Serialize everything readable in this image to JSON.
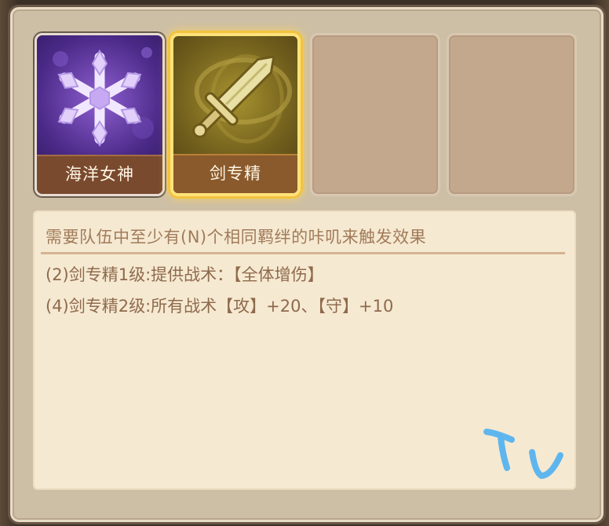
{
  "slots": [
    {
      "label": "海洋女神",
      "icon": "snowflake-icon",
      "selected": false
    },
    {
      "label": "剑专精",
      "icon": "sword-icon",
      "selected": true
    },
    {
      "label": "",
      "empty": true
    },
    {
      "label": "",
      "empty": true
    }
  ],
  "description": {
    "header": "需要队伍中至少有(N)个相同羁绊的咔叽来触发效果",
    "lines": [
      "(2)剑专精1级:提供战术：【全体增伤】",
      "(4)剑专精2级:所有战术【攻】+20、【守】+10"
    ]
  },
  "watermark": {
    "text": "TV",
    "color": "#5fb6ee"
  },
  "colors": {
    "panel": "#cdbfa6",
    "text_desc": "#8e6a4c",
    "highlight": "#f3c33e",
    "label_bg": "#7a4a2e"
  }
}
